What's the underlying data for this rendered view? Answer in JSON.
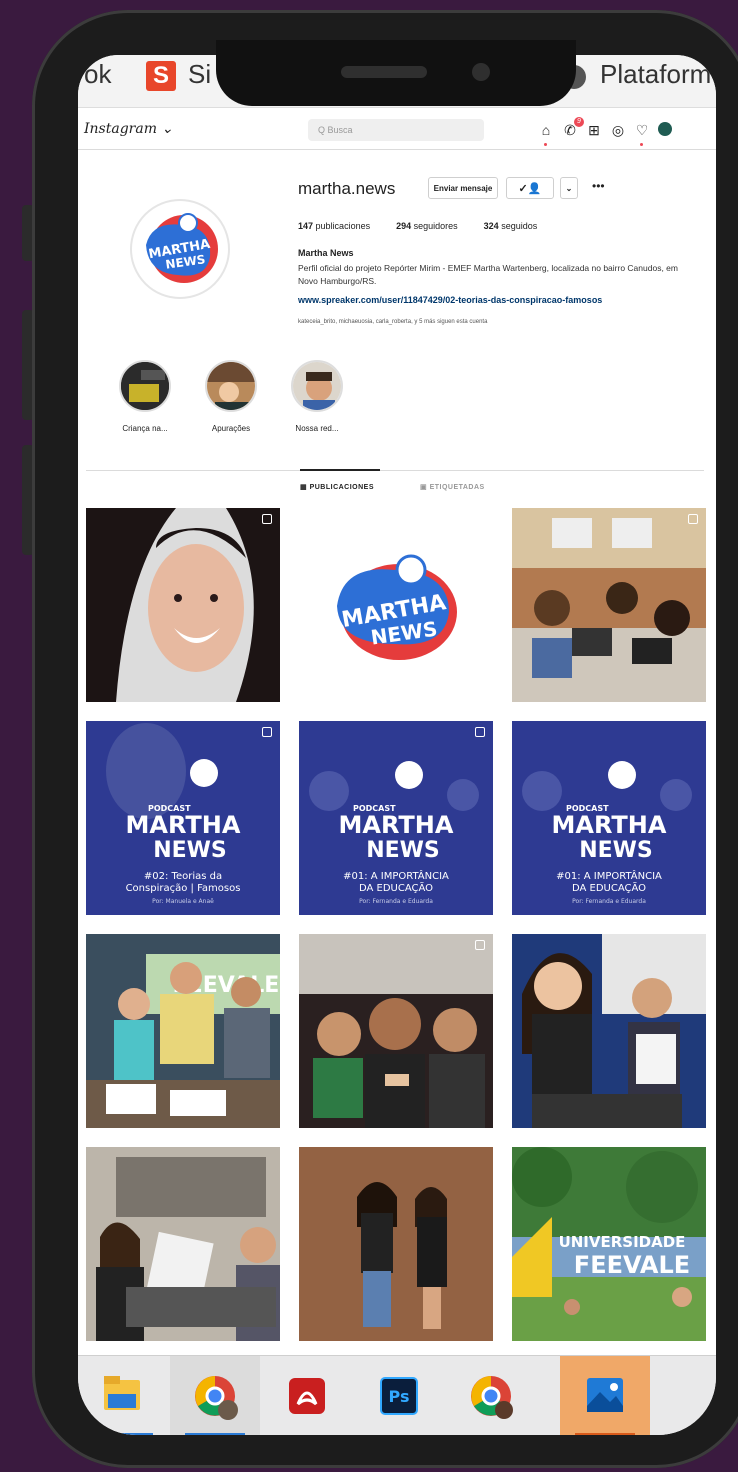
{
  "browser": {
    "tab_left_fragment": "ok",
    "tab_s_icon": "S",
    "tab_s_text": "Si",
    "tab_right_text": "Plataform"
  },
  "instagram": {
    "logo": "Instagram",
    "search_placeholder": "Q  Busca",
    "icons": [
      "home-icon",
      "messenger-icon",
      "new-post-icon",
      "explore-icon",
      "heart-icon",
      "profile-avatar-icon"
    ],
    "messenger_badge": "9"
  },
  "profile": {
    "username": "martha.news",
    "message_button": "Enviar mensaje",
    "stats": {
      "posts_count": "147",
      "posts_label": "publicaciones",
      "followers_count": "294",
      "followers_label": "seguidores",
      "following_count": "324",
      "following_label": "seguidos"
    },
    "name": "Martha News",
    "bio": "Perfil oficial do projeto Repórter Mirim - EMEF Martha Wartenberg, localizada no bairro Canudos, em Novo Hamburgo/RS.",
    "link": "www.spreaker.com/user/11847429/02-teorias-das-conspiracao-famosos",
    "followed_by": "kateceia_brito, michaeuosia, carla_roberta, y 5 más siguen esta cuenta",
    "logo_text_line1": "MARTHA",
    "logo_text_line2": "NEWS"
  },
  "highlights": [
    {
      "label": "Criança na..."
    },
    {
      "label": "Apurações"
    },
    {
      "label": "Nossa red..."
    }
  ],
  "tabs": {
    "posts": "PUBLICACIONES",
    "tagged": "ETIQUETADAS"
  },
  "posts": {
    "podcast_label": "PODCAST",
    "title_line1": "MARTHA",
    "title_line2": "NEWS",
    "ep2_line1": "#02: Teorias da",
    "ep2_line2": "Conspiração | Famosos",
    "ep2_byline": "Por: Manuela e Anaê",
    "ep1_line1": "#01: A IMPORTÂNCIA",
    "ep1_line2": "DA EDUCAÇÃO",
    "ep1_byline": "Por: Fernanda e Eduarda",
    "feevale_text_1": "UNIVERSIDADE",
    "feevale_text_2": "FEEVALE",
    "feevale_wall": "FEEVALE"
  },
  "taskbar": {
    "items": [
      "file-explorer-icon",
      "chrome-profile-icon",
      "acrobat-icon",
      "photoshop-icon",
      "chrome-icon",
      "photos-icon"
    ],
    "ps_label": "Ps"
  },
  "colors": {
    "background": "#3a1a3f",
    "logo_blue": "#2d6fd6",
    "logo_red": "#e53c3c",
    "podcast_navy": "#2e3a92"
  }
}
